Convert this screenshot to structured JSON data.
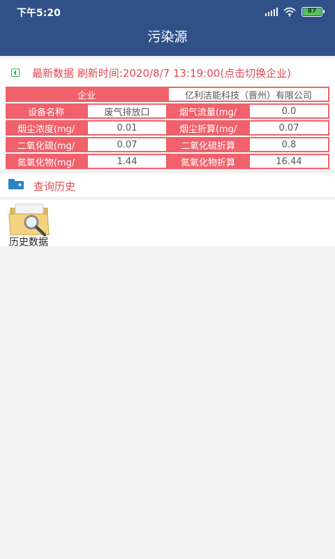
{
  "status_bar": {
    "time": "下午5:20",
    "battery": "87"
  },
  "header": {
    "title": "污染源"
  },
  "latest": {
    "refresh_text": "最新数据 刷新时间:2020/8/7 13:19:00(点击切换企业)"
  },
  "table": {
    "enterprise_label": "企业",
    "enterprise_value": "亿利洁能科技（晋州）有限公司",
    "rows": [
      {
        "l1": "设备名称",
        "v1": "废气排放口",
        "l2": "烟气流量(mg/",
        "v2": "0.0"
      },
      {
        "l1": "烟尘浓度(mg/",
        "v1": "0.01",
        "l2": "烟尘折算(mg/",
        "v2": "0.07"
      },
      {
        "l1": "二氧化硫(mg/",
        "v1": "0.07",
        "l2": "二氧化硫折算",
        "v2": "0.8"
      },
      {
        "l1": "氮氧化物(mg/",
        "v1": "1.44",
        "l2": "氮氧化物折算",
        "v2": "16.44"
      }
    ]
  },
  "history": {
    "title": "查询历史",
    "item_label": "历史数据"
  }
}
